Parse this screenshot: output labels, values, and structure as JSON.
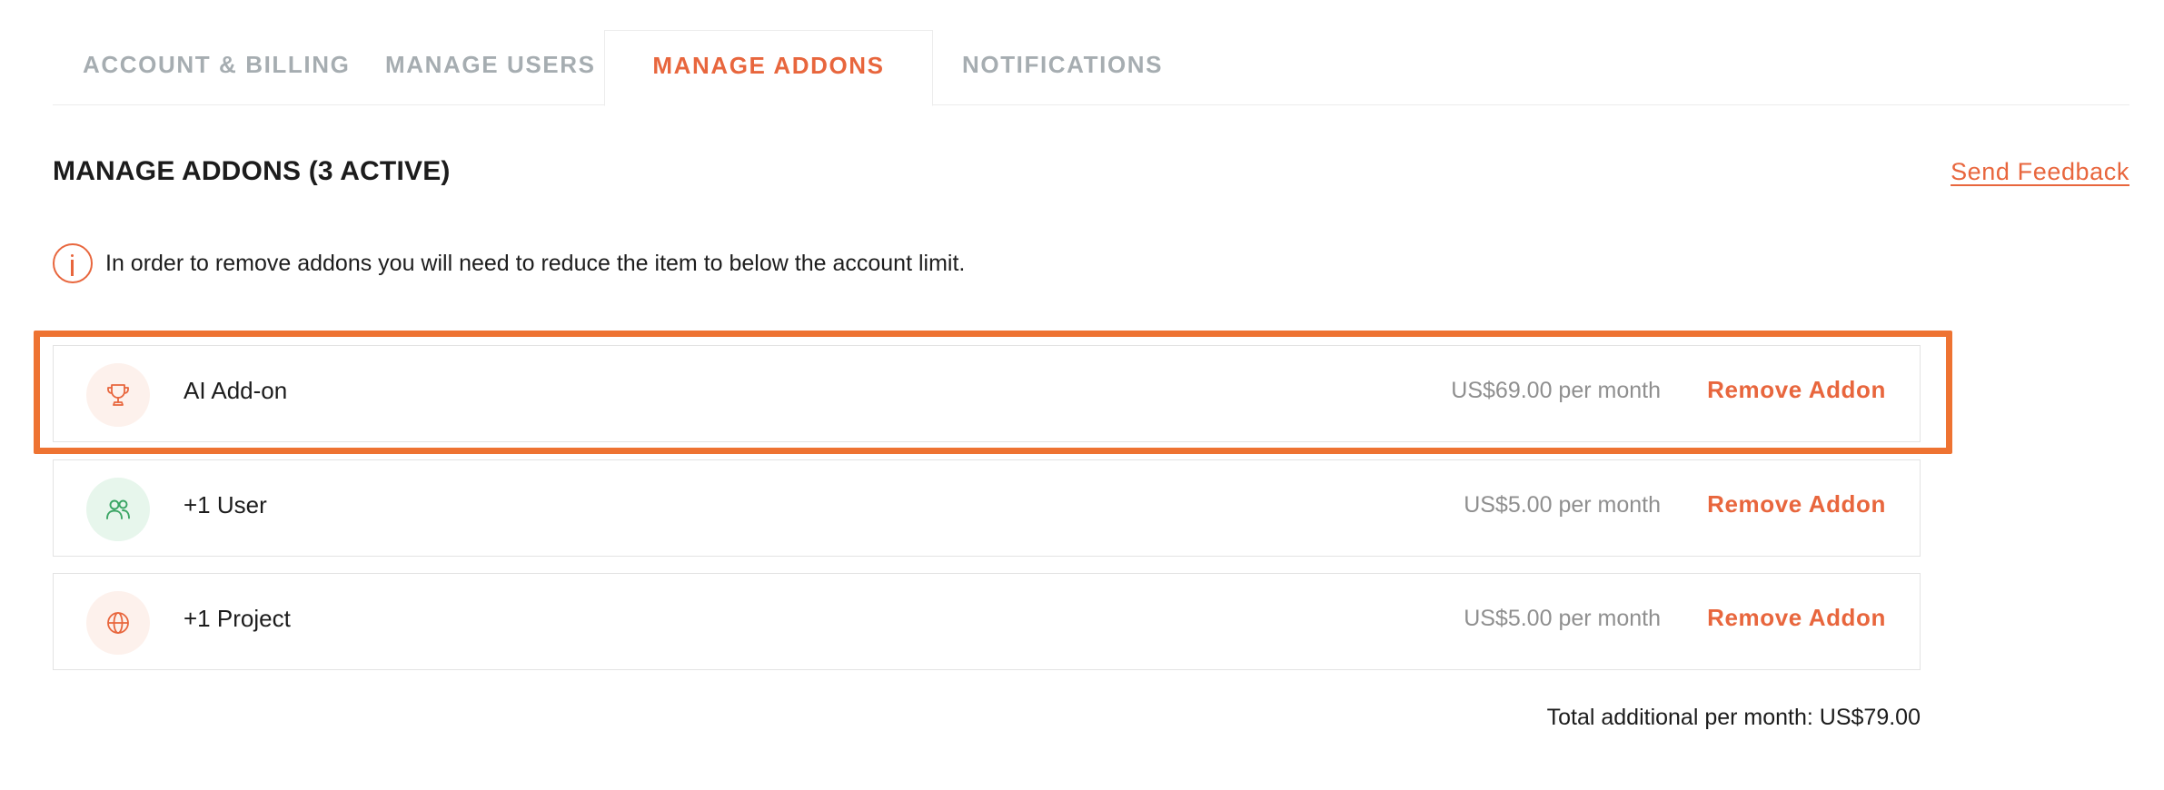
{
  "tabs": [
    {
      "label": "ACCOUNT & BILLING",
      "active": false
    },
    {
      "label": "MANAGE USERS",
      "active": false
    },
    {
      "label": "MANAGE ADDONS",
      "active": true
    },
    {
      "label": "NOTIFICATIONS",
      "active": false
    }
  ],
  "header": {
    "title": "MANAGE ADDONS (3 ACTIVE)",
    "feedback_link": "Send Feedback"
  },
  "notice": {
    "icon": "info-icon",
    "text": "In order to remove addons you will need to reduce the item to below the account limit."
  },
  "addons": [
    {
      "name": "AI Add-on",
      "price": "US$69.00 per month",
      "action": "Remove Addon",
      "icon": "trophy-icon",
      "highlighted": true
    },
    {
      "name": "+1 User",
      "price": "US$5.00 per month",
      "action": "Remove Addon",
      "icon": "users-icon",
      "highlighted": false
    },
    {
      "name": "+1 Project",
      "price": "US$5.00 per month",
      "action": "Remove Addon",
      "icon": "globe-icon",
      "highlighted": false
    }
  ],
  "total": "Total additional per month: US$79.00",
  "colors": {
    "accent": "#e8663d",
    "highlight": "#ee7332",
    "tab_inactive": "#a6adb1",
    "price_text": "#8f8f8f",
    "user_icon": "#3aa564"
  }
}
